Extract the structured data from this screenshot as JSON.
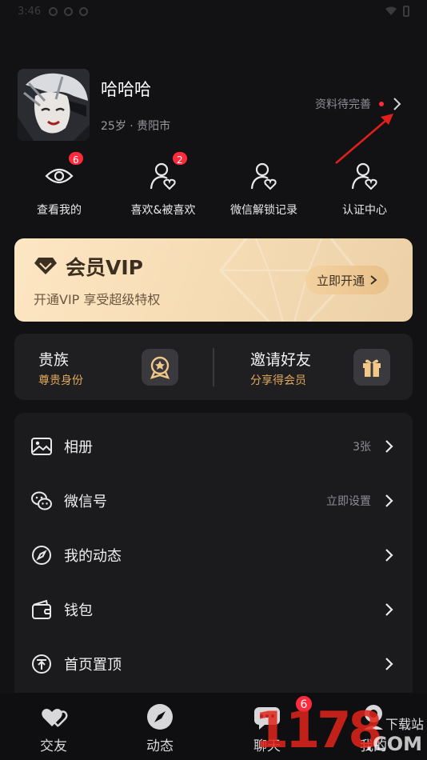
{
  "status_bar": {
    "time": "3:46"
  },
  "profile": {
    "name": "哈哈哈",
    "meta": "25岁 · 贵阳市",
    "link_text": "资料待完善"
  },
  "quick_actions": [
    {
      "label": "查看我的",
      "badge": "6",
      "icon": "eye-icon"
    },
    {
      "label": "喜欢&被喜欢",
      "badge": "2",
      "icon": "user-heart-icon"
    },
    {
      "label": "微信解锁记录",
      "badge": null,
      "icon": "user-heart-icon"
    },
    {
      "label": "认证中心",
      "badge": null,
      "icon": "user-heart-icon"
    }
  ],
  "vip": {
    "title": "会员VIP",
    "subtitle": "开通VIP 享受超级特权",
    "button": "立即开通",
    "colors": {
      "bg_start": "#fde6c3",
      "bg_end": "#ecd1a7",
      "text": "#3c2f22"
    }
  },
  "promos": [
    {
      "title": "贵族",
      "subtitle": "尊贵身份",
      "icon": "noble-badge-icon"
    },
    {
      "title": "邀请好友",
      "subtitle": "分享得会员",
      "icon": "gift-icon"
    }
  ],
  "menu": [
    {
      "label": "相册",
      "value": "3张",
      "icon": "album-icon"
    },
    {
      "label": "微信号",
      "value": "立即设置",
      "icon": "wechat-icon"
    },
    {
      "label": "我的动态",
      "value": "",
      "icon": "compass-icon"
    },
    {
      "label": "钱包",
      "value": "",
      "icon": "wallet-icon"
    },
    {
      "label": "首页置顶",
      "value": "",
      "icon": "pin-top-icon"
    }
  ],
  "tabs": [
    {
      "label": "交友",
      "icon": "hearts-icon",
      "badge": null
    },
    {
      "label": "动态",
      "icon": "compass-icon",
      "badge": null
    },
    {
      "label": "聊天",
      "icon": "chat-icon",
      "badge": "6"
    },
    {
      "label": "我的",
      "icon": "profile-icon",
      "badge": null
    }
  ],
  "watermark": {
    "digits": "1178",
    "site": "下载站",
    "domain": ".COM"
  },
  "colors": {
    "background": "#121214",
    "card": "#1b1b1e",
    "accent_red": "#ff2a3c",
    "gold": "#e0a85b"
  }
}
